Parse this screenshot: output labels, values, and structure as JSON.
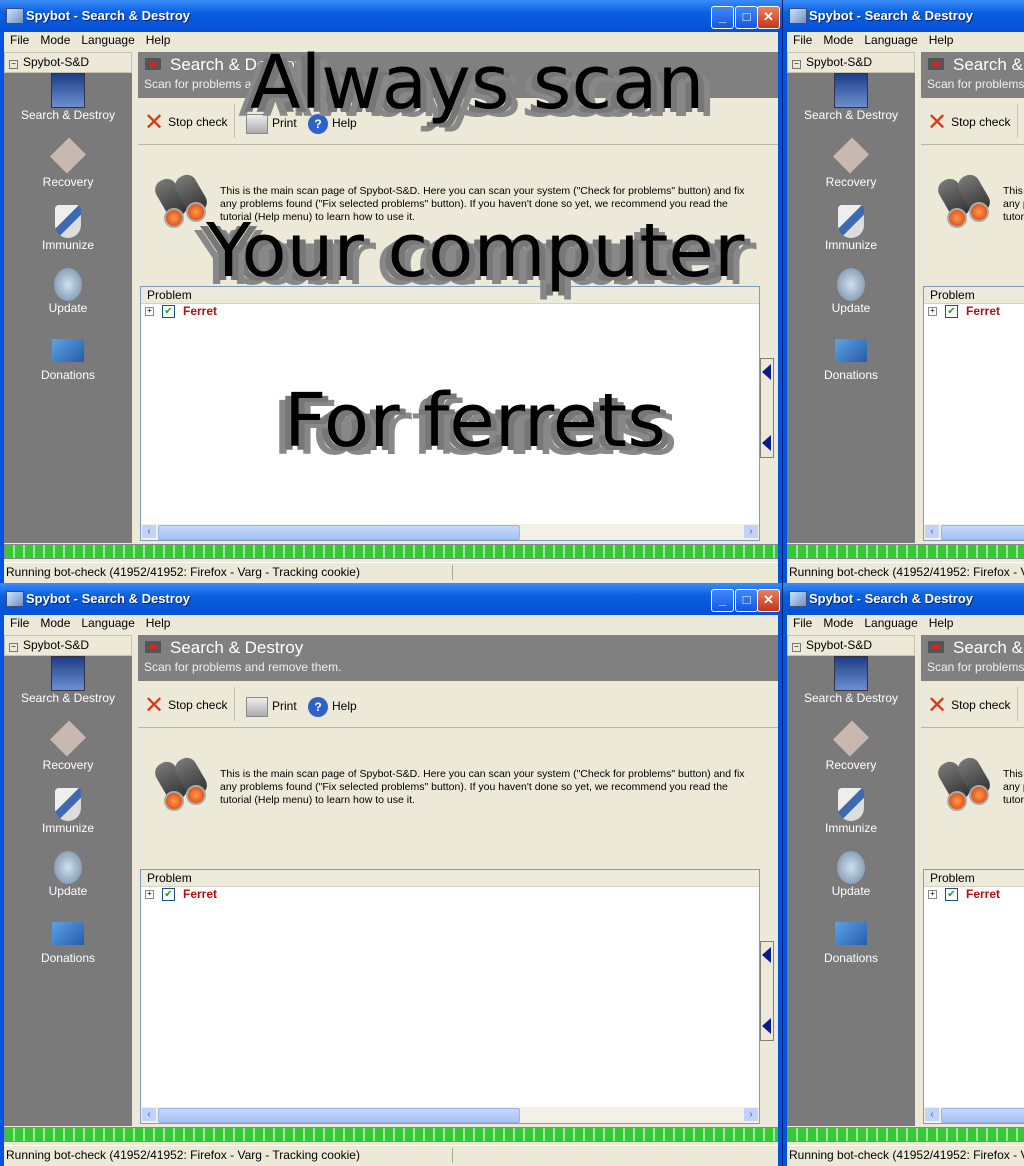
{
  "window": {
    "title": "Spybot - Search & Destroy",
    "controls": {
      "minimize": "_",
      "maximize": "□",
      "close": "✕"
    }
  },
  "menu": [
    "File",
    "Mode",
    "Language",
    "Help"
  ],
  "sidebar": {
    "header": "Spybot-S&D",
    "items": [
      {
        "label": "Search & Destroy",
        "icon": "search-destroy-icon"
      },
      {
        "label": "Recovery",
        "icon": "recovery-icon"
      },
      {
        "label": "Immunize",
        "icon": "shield-icon"
      },
      {
        "label": "Update",
        "icon": "update-globe-icon"
      },
      {
        "label": "Donations",
        "icon": "credit-card-icon"
      }
    ]
  },
  "header": {
    "title": "Search & Destroy",
    "subtitle": "Scan for problems and remove them."
  },
  "toolbar": {
    "stop": "Stop check",
    "print": "Print",
    "help": "Help"
  },
  "description": "This is the main scan page of Spybot-S&D. Here you can scan your system (\"Check for problems\" button) and fix any problems found (\"Fix selected problems\" button). If you haven't done so yet, we recommend you read the tutorial (Help menu) to learn how to use it.",
  "grid": {
    "column": "Problem",
    "rows": [
      {
        "label": "Ferret",
        "checked": true
      }
    ]
  },
  "progress": {
    "percent": 100
  },
  "status": "Running bot-check (41952/41952: Firefox - Varg - Tracking cookie)",
  "overlay": {
    "line1": "Always scan",
    "line2": "Your computer",
    "line3": "For ferrets"
  }
}
